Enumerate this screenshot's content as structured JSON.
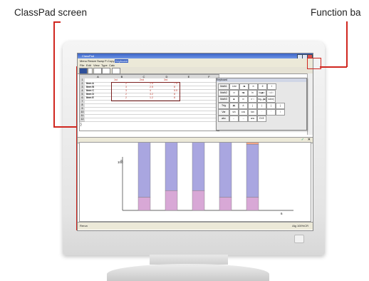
{
  "callouts": {
    "left": "ClassPad screen",
    "right": "Function ba"
  },
  "app": {
    "title": "ClassPad",
    "menus_top": [
      "Menu",
      "Resize",
      "Swap",
      "P-Copy",
      "Keyboard"
    ],
    "menus_main": [
      "File",
      "Edit",
      "View",
      "Type",
      "Calc"
    ]
  },
  "sheet": {
    "columns": [
      "A",
      "B",
      "C",
      "D",
      "E",
      "F"
    ],
    "rows": [
      "1",
      "2",
      "3",
      "4",
      "5",
      "6",
      "7",
      "8",
      "9",
      "10",
      "11",
      "12"
    ],
    "headers": [
      "1st",
      "2nd",
      "3rd"
    ],
    "items": [
      {
        "label": "Item A",
        "v1": "2",
        "v2": "1.5",
        "v3": "7.5"
      },
      {
        "label": "Item B",
        "v1": "3",
        "v2": "2.5",
        "v3": "8"
      },
      {
        "label": "Item C",
        "v1": "3",
        "v2": "4",
        "v3": "5.5"
      },
      {
        "label": "Item D",
        "v1": "2",
        "v2": "3.2",
        "v3": "8"
      },
      {
        "label": "Item E",
        "v1": "2",
        "v2": "1.2",
        "v3": "8"
      }
    ],
    "cursor": "}"
  },
  "keyboard": {
    "title": "Keyboard",
    "tabs": [
      "Math1",
      "Math2",
      "Math3",
      "Trig",
      "Var",
      "abc"
    ],
    "line_btn": "Line",
    "keys": [
      [
        "√■",
        "π",
        "θ",
        "t"
      ],
      [
        "□²",
        "e■",
        "ln",
        "log■□",
        "□√□"
      ],
      [
        "■",
        "x²",
        "x⁻¹",
        "log₁₀(■)",
        "solve("
      ],
      [
        "|■|",
        "∠",
        "(",
        ")",
        "{",
        "}"
      ],
      [
        "sin",
        "cos",
        "tan",
        "·",
        "'",
        "/"
      ],
      [
        "←",
        "→",
        "ans",
        "EXE"
      ]
    ]
  },
  "chart_data": {
    "type": "bar",
    "stacked": true,
    "categories": [
      "Item A",
      "Item B",
      "Item C",
      "Item D",
      "Item E"
    ],
    "series": [
      {
        "name": "1st",
        "values": [
          2,
          3,
          3,
          2,
          2
        ],
        "color": "#d8a8d6"
      },
      {
        "name": "2nd",
        "values": [
          9,
          8,
          8,
          9,
          8
        ],
        "color": "#a9a6e0"
      },
      {
        "name": "3rd",
        "values": [
          11,
          10,
          10,
          10,
          10
        ],
        "color": "#f3a585"
      }
    ],
    "y_tick_label": "100",
    "x_tick_label": "6",
    "ylim": [
      0,
      100
    ]
  },
  "status": {
    "left": "Rerun",
    "right": "Alg      100%CR"
  },
  "colors": {
    "leader": "#d0261f",
    "titlebar": "#3b63c4"
  }
}
